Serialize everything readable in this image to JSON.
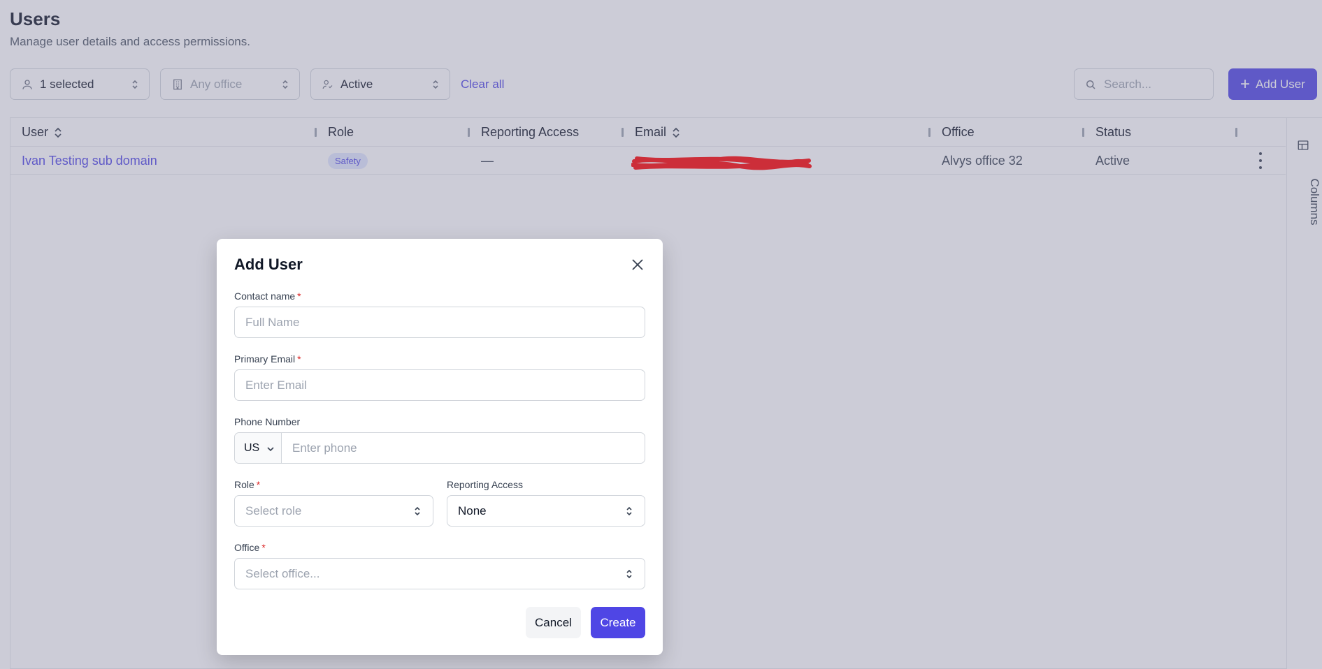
{
  "page": {
    "title": "Users",
    "subtitle": "Manage user details and access permissions."
  },
  "filters": {
    "user_filter": "1 selected",
    "office_filter": "Any office",
    "status_filter": "Active",
    "clear_all": "Clear all"
  },
  "search": {
    "placeholder": "Search..."
  },
  "toolbar": {
    "add_user_label": "Add User"
  },
  "table": {
    "columns": [
      "User",
      "Role",
      "Reporting Access",
      "Email",
      "Office",
      "Status"
    ],
    "rows": [
      {
        "user": "Ivan Testing sub domain",
        "role": "Safety",
        "reporting_access": "—",
        "email": "",
        "office": "Alvys office 32",
        "status": "Active"
      }
    ],
    "columns_panel_label": "Columns"
  },
  "modal": {
    "title": "Add User",
    "contact_name_label": "Contact name",
    "contact_name_placeholder": "Full Name",
    "primary_email_label": "Primary Email",
    "primary_email_placeholder": "Enter Email",
    "phone_label": "Phone Number",
    "country_code": "US",
    "phone_placeholder": "Enter phone",
    "role_label": "Role",
    "role_placeholder": "Select role",
    "reporting_access_label": "Reporting Access",
    "reporting_access_value": "None",
    "office_label": "Office",
    "office_placeholder": "Select office...",
    "required_marker": "*",
    "cancel_label": "Cancel",
    "create_label": "Create"
  },
  "colors": {
    "accent": "#4f46e5",
    "required": "#dc2626",
    "redaction": "#ff0000"
  }
}
